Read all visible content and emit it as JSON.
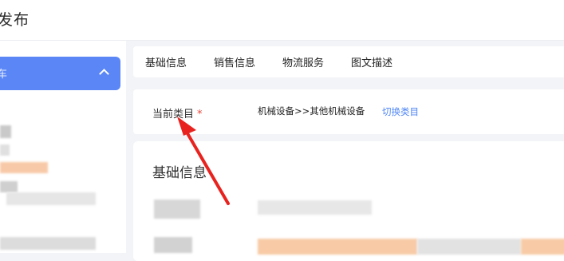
{
  "header": {
    "title": "发布"
  },
  "sidebar": {
    "active_label": "车"
  },
  "tabs": [
    {
      "label": "基础信息"
    },
    {
      "label": "销售信息"
    },
    {
      "label": "物流服务"
    },
    {
      "label": "图文描述"
    }
  ],
  "category": {
    "label": "当前类目",
    "required_mark": "*",
    "path": "机械设备>>其他机械设备",
    "switch_label": "切换类目"
  },
  "basic_info": {
    "title": "基础信息"
  },
  "annotation": {
    "color": "#e8231f"
  },
  "colors": {
    "accent": "#5a86f6",
    "link": "#4f86f5",
    "required": "#e8453c",
    "background": "#f3f4f7"
  }
}
